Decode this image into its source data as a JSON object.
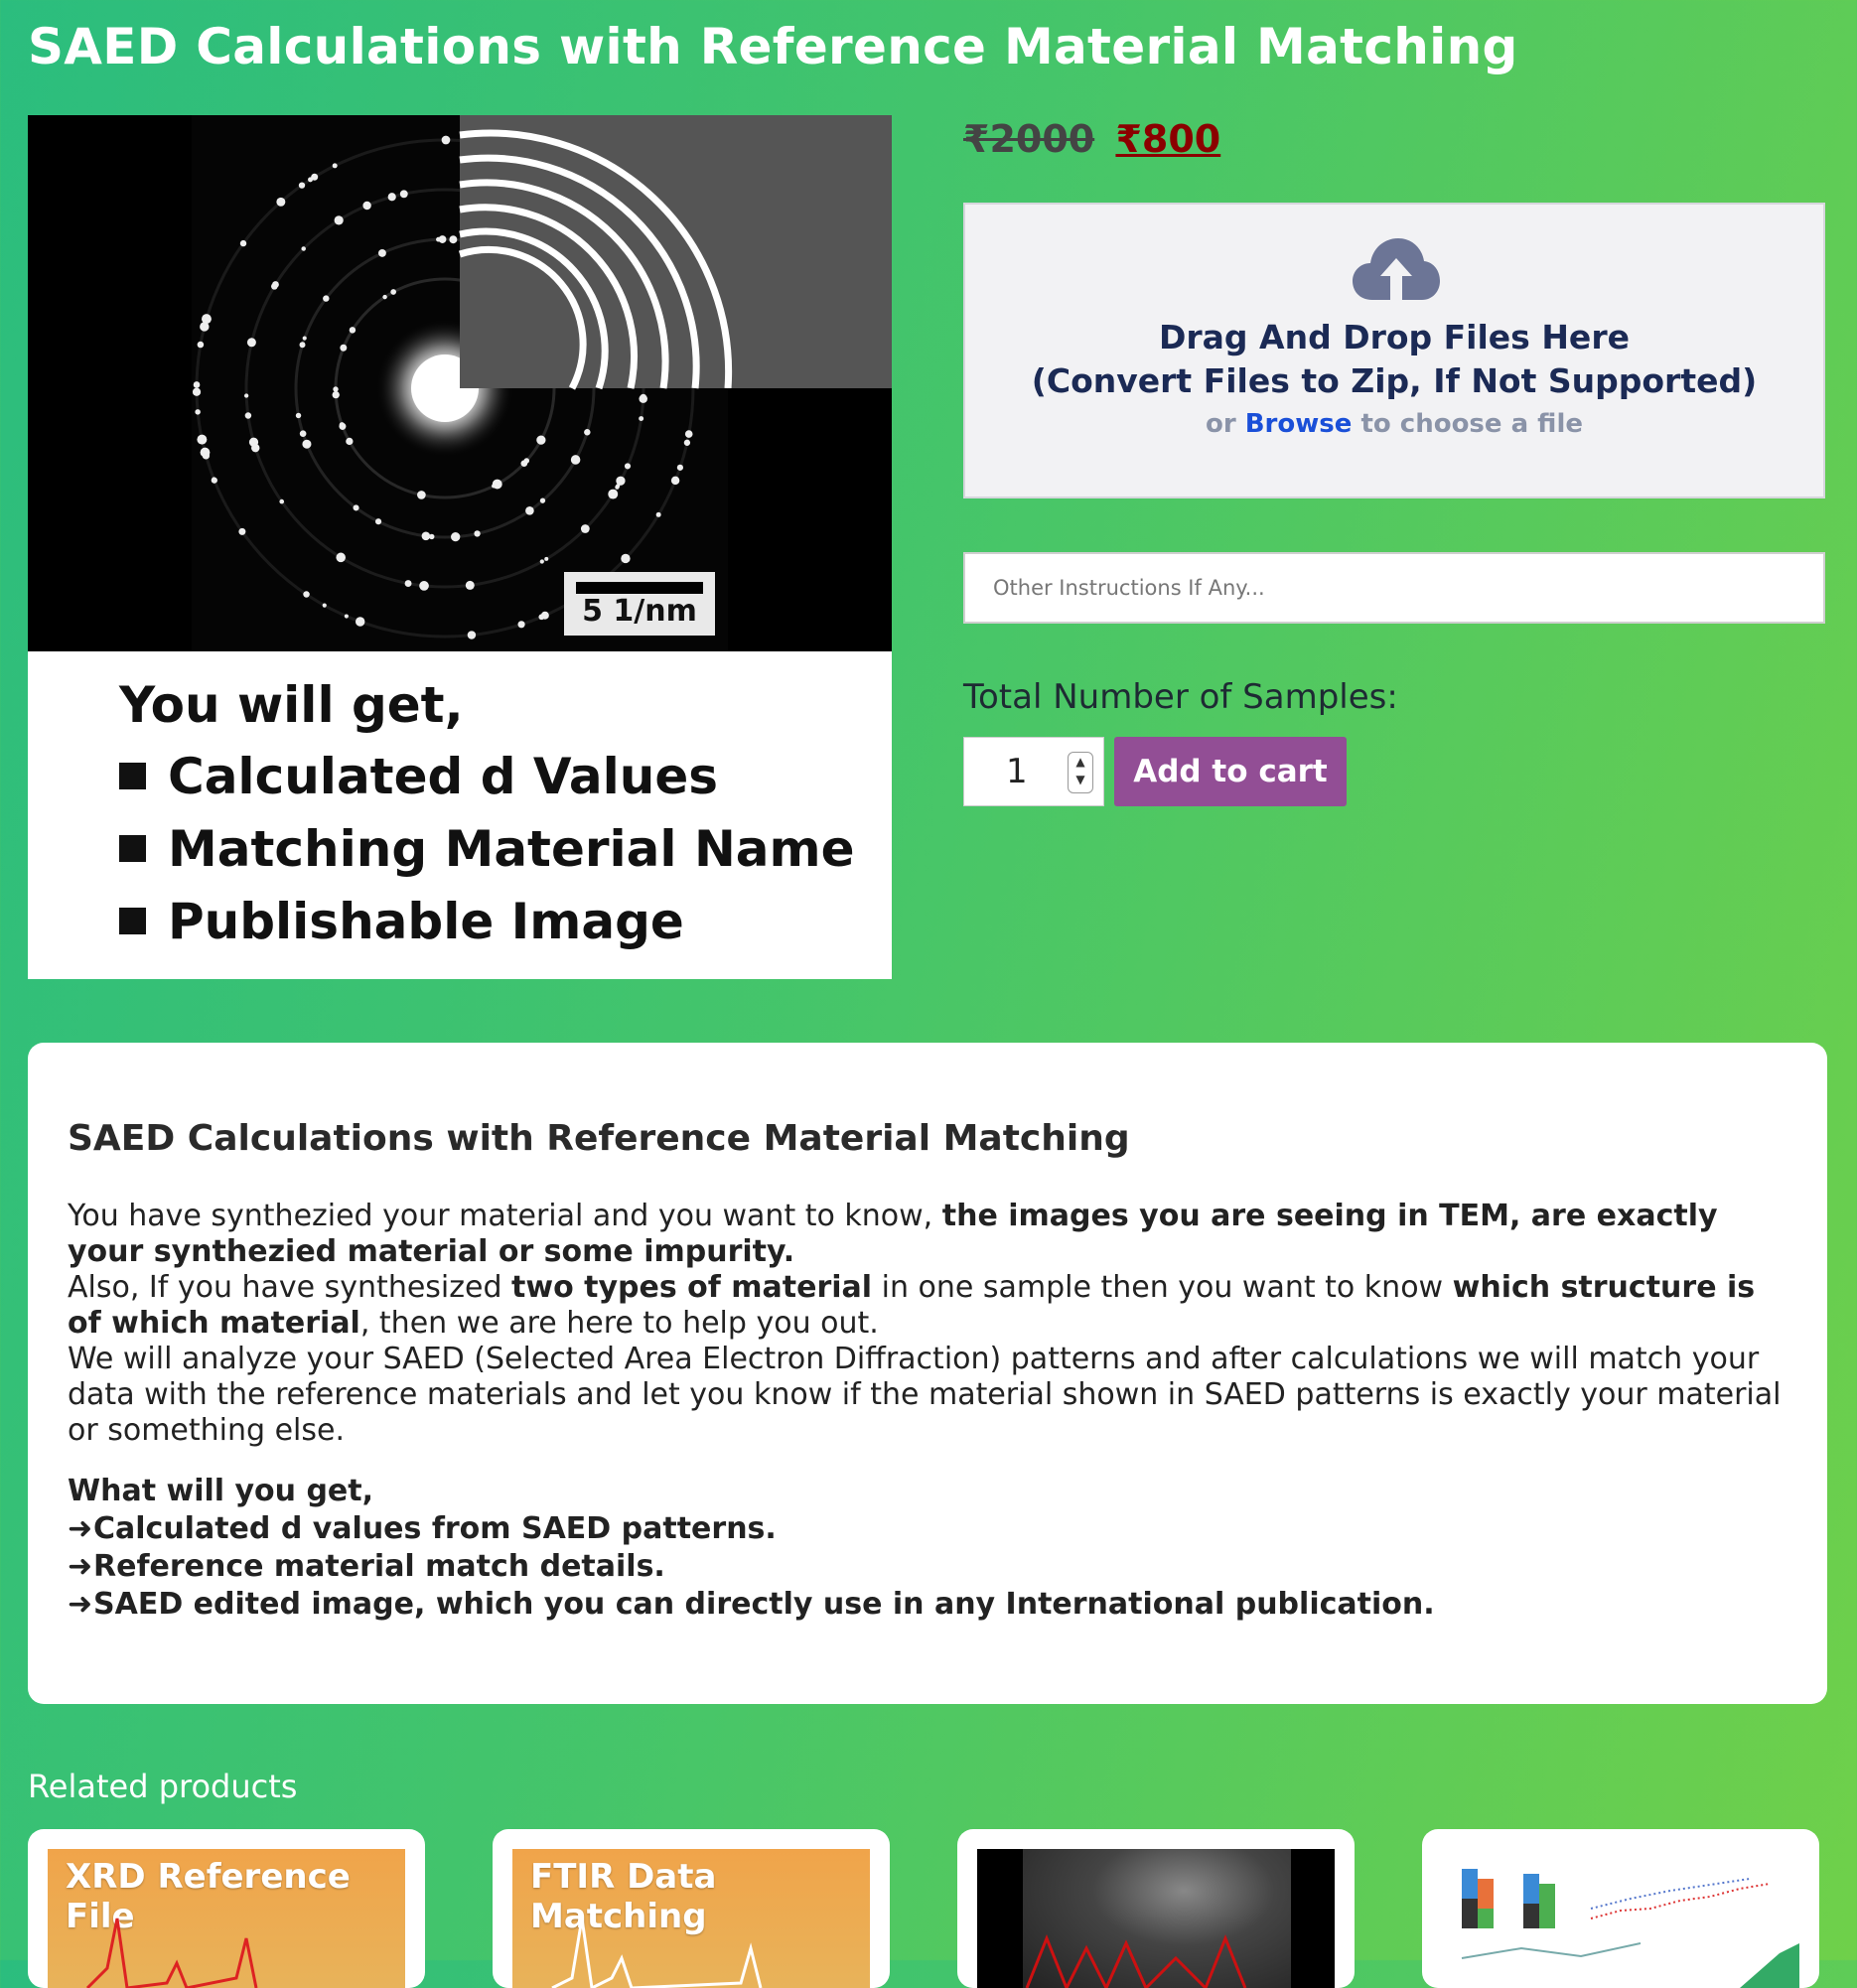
{
  "page": {
    "title": "SAED Calculations with Reference Material Matching"
  },
  "product_image": {
    "scale_bar": "5 1/nm",
    "benefits_heading": "You will get,",
    "benefits": [
      "Calculated d Values",
      "Matching Material Name",
      "Publishable Image"
    ]
  },
  "price": {
    "old": "₹2000",
    "new": "₹800"
  },
  "dropzone": {
    "title_line1": "Drag And Drop Files Here",
    "title_line2": "(Convert Files to Zip, If Not Supported)",
    "or": "or",
    "browse": "Browse",
    "suffix": "to choose a file",
    "icon": "cloud-upload-icon"
  },
  "instructions": {
    "placeholder": "Other Instructions If Any..."
  },
  "cart": {
    "samples_label": "Total Number of Samples:",
    "quantity": "1",
    "add_to_cart": "Add to cart",
    "button_color": "#924e95"
  },
  "description": {
    "title": "SAED Calculations with Reference Material Matching",
    "p1_a": "You have synthezied your material and you want to know, ",
    "p1_b": "the images you are seeing in TEM, are exactly your synthezied material or some impurity.",
    "p2_a": "Also, If you have synthesized ",
    "p2_b": "two types of material",
    "p2_c": " in one sample then you want to know ",
    "p2_d": "which structure is of which material",
    "p2_e": ", then we are here to help you out.",
    "p3": "We will analyze your SAED (Selected Area Electron Diffraction) patterns and after calculations we will match your data with the reference materials and let you know if the material shown in SAED patterns is exactly your material or something else.",
    "get_heading": "What will you get,",
    "get_items": [
      "Calculated d values from SAED patterns.",
      "Reference material match details.",
      "SAED edited image, which you can directly use in any International publication."
    ]
  },
  "related": {
    "heading": "Related products",
    "items": [
      {
        "label": "XRD Reference File"
      },
      {
        "label": "FTIR Data Matching"
      }
    ]
  },
  "colors": {
    "price_new": "#8b0000",
    "browse_link": "#1a4fd8"
  }
}
